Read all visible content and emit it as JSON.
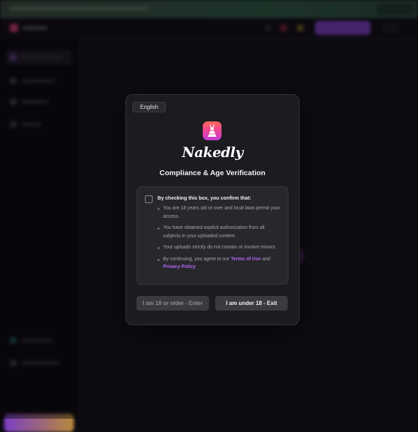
{
  "modal": {
    "language": "English",
    "brand": "Nakedly",
    "title": "Compliance & Age Verification",
    "consent_heading": "By checking this box, you confirm that:",
    "bullets": [
      "You are 18 years old or over and local laws permit your access.",
      "You have obtained explicit authorization from all subjects in your uploaded content.",
      "Your uploads strictly do not contain or involve minors."
    ],
    "agree_prefix": "By continuing, you agree to our ",
    "terms_link": "Terms of Use",
    "agree_and": " and ",
    "privacy_link": "Privacy Policy",
    "enter_button": "I am 18 or older - Enter",
    "exit_button": "I am under 18 - Exit",
    "checkbox_checked": false
  },
  "icons": {
    "app_icon": "dress-icon"
  },
  "colors": {
    "accent": "#b266f0",
    "icon_gradient": [
      "#ff6a5a",
      "#f24590",
      "#c23bd4"
    ]
  }
}
